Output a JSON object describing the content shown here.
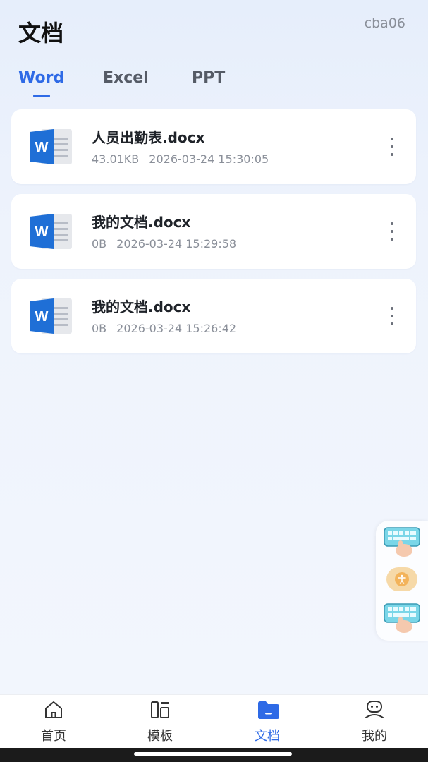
{
  "header": {
    "title": "文档",
    "user_id": "cba06"
  },
  "tabs": [
    {
      "label": "Word",
      "active": true
    },
    {
      "label": "Excel",
      "active": false
    },
    {
      "label": "PPT",
      "active": false
    }
  ],
  "files": [
    {
      "name": "人员出勤表.docx",
      "size": "43.01KB",
      "date": "2026-03-24 15:30:05",
      "icon": "word-file-icon"
    },
    {
      "name": "我的文档.docx",
      "size": "0B",
      "date": "2026-03-24 15:29:58",
      "icon": "word-file-icon"
    },
    {
      "name": "我的文档.docx",
      "size": "0B",
      "date": "2026-03-24 15:26:42",
      "icon": "word-file-icon"
    }
  ],
  "bottom_nav": [
    {
      "label": "首页",
      "icon": "home-icon",
      "active": false
    },
    {
      "label": "模板",
      "icon": "template-icon",
      "active": false
    },
    {
      "label": "文档",
      "icon": "folder-icon",
      "active": true
    },
    {
      "label": "我的",
      "icon": "profile-icon",
      "active": false
    }
  ],
  "colors": {
    "accent": "#2e6ae6",
    "word_blue": "#1f6fd6",
    "background": "#eef3fc"
  }
}
